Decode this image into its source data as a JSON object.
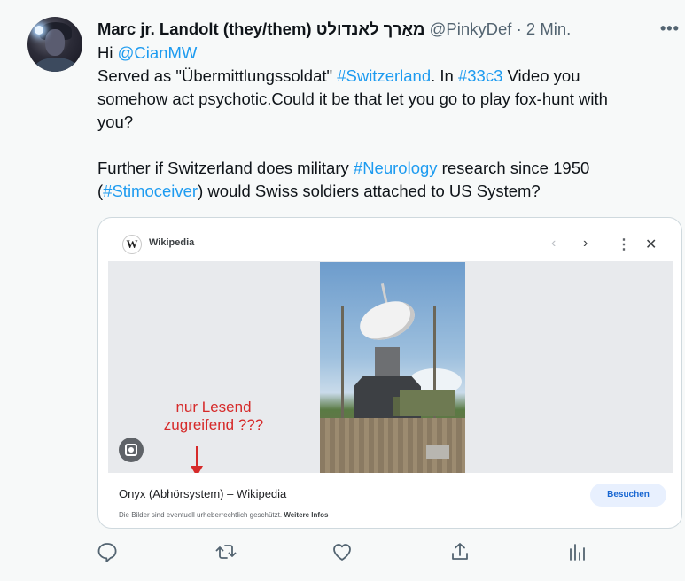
{
  "author": {
    "name": "Marc jr. Landolt (they/them) מאַרך לאנדולט",
    "handle": "@PinkyDef",
    "separator": "·",
    "time": "2 Min."
  },
  "tweet": {
    "line1_prefix": "Hi ",
    "mention": "@CianMW",
    "line2_a": "Served as \"Übermittlungssoldat\" ",
    "hashtag_switzerland": "#Switzerland",
    "line2_b": ". In ",
    "hashtag_33c3": "#33c3",
    "line2_c": " Video you",
    "line3": "somehow act psychotic.Could it be that let you go to play fox-hunt with",
    "line4": "you?",
    "line5_a": "Further if Switzerland does military ",
    "hashtag_neurology": "#Neurology",
    "line5_b": " research since 1950",
    "line6_a": "(",
    "hashtag_stimoceiver": "#Stimoceiver",
    "line6_b": ") would Swiss soldiers attached to US System?"
  },
  "card": {
    "source_logo": "W",
    "source_name": "Wikipedia",
    "annotation_line1": "nur Lesend",
    "annotation_line2": "zugreifend ???",
    "page_title": "Onyx (Abhörsystem) – Wikipedia",
    "visit_label": "Besuchen",
    "disclaimer_text": "Die Bilder sind eventuell urheberrechtlich geschützt. ",
    "disclaimer_link": "Weitere Infos",
    "nav_icons": [
      "chevron-left-icon",
      "chevron-right-icon",
      "more-vertical-icon",
      "close-icon"
    ]
  },
  "actions": [
    "reply-icon",
    "retweet-icon",
    "like-icon",
    "share-icon",
    "analytics-icon"
  ],
  "colors": {
    "link": "#1d9bf0",
    "secondary_text": "#536471",
    "annotation": "#d62a2a",
    "visit_button": "#1967d2"
  }
}
